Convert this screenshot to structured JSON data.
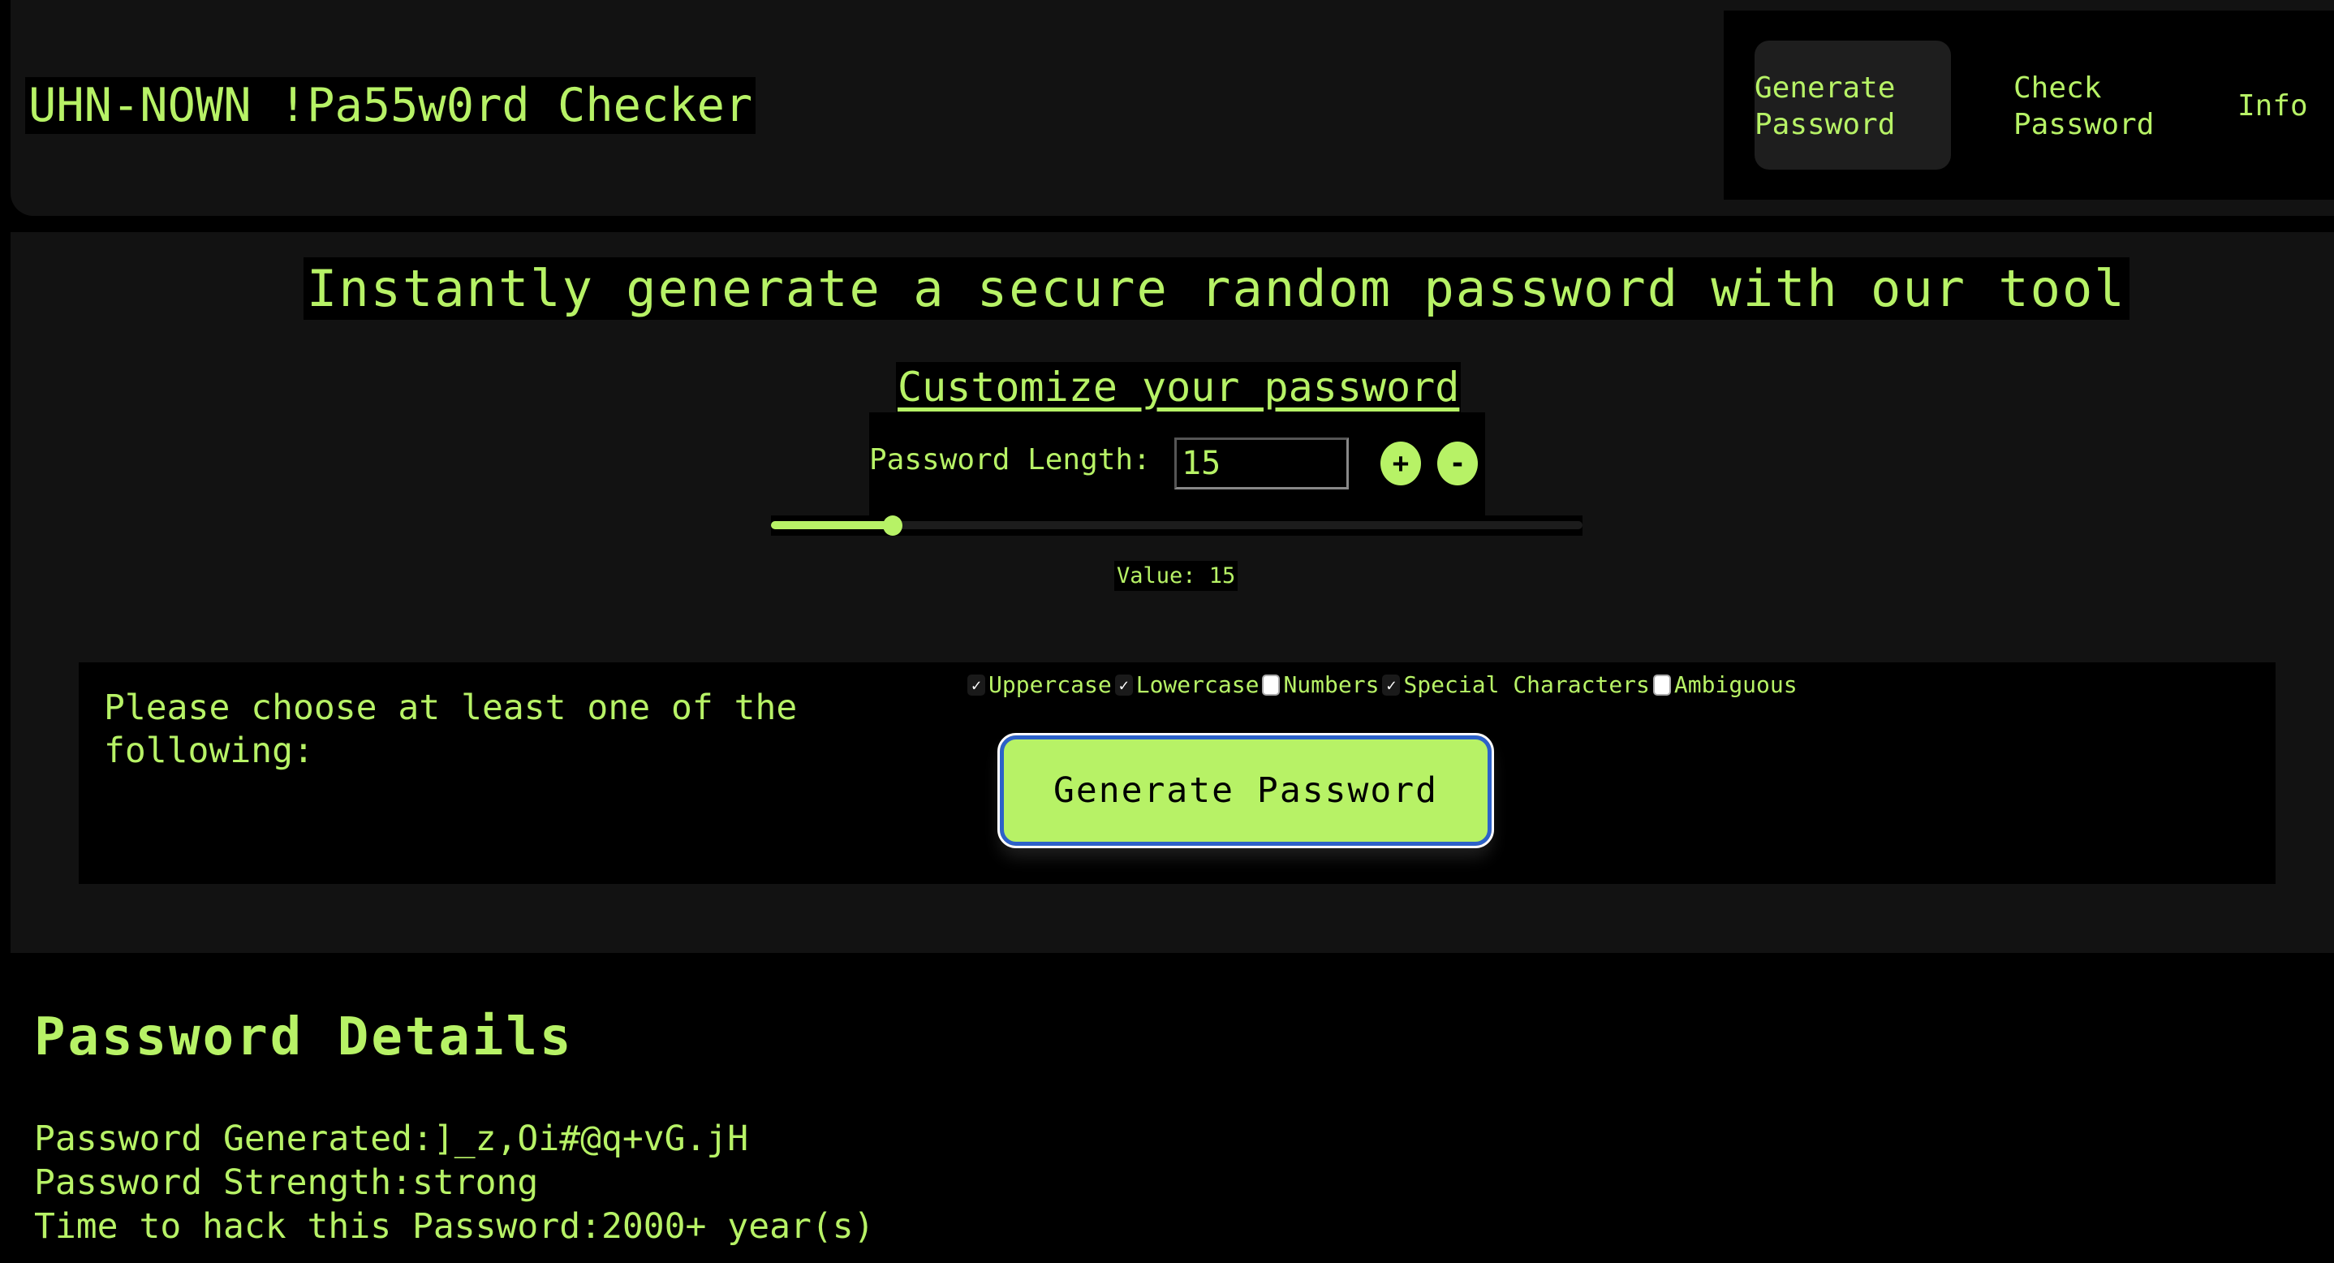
{
  "header": {
    "title": "UHN-NOWN !Pa55w0rd Checker",
    "nav": [
      {
        "label": "Generate\nPassword",
        "active": true
      },
      {
        "label": "Check\nPassword",
        "active": false
      },
      {
        "label": "Info",
        "active": false
      }
    ]
  },
  "main": {
    "headline": "Instantly generate a secure random password with our tool",
    "customize_heading": "Customize your password",
    "length_label": "Password Length:",
    "length_value": "15",
    "plus_label": "+",
    "minus_label": "-",
    "slider": {
      "value": 15,
      "fill_percent": 15
    },
    "value_text": "Value: 15",
    "choose_text": "Please choose at least one of the following:",
    "options": [
      {
        "label": "Uppercase",
        "checked": true
      },
      {
        "label": "Lowercase",
        "checked": true
      },
      {
        "label": "Numbers",
        "checked": false
      },
      {
        "label": "Special Characters",
        "checked": true
      },
      {
        "label": "Ambiguous",
        "checked": false
      }
    ],
    "generate_button": "Generate Password"
  },
  "details": {
    "heading": "Password Details",
    "generated": "Password Generated:]_z,Oi#@q+vG.jH",
    "strength": "Password Strength:strong",
    "time_to_hack": "Time to hack this Password:2000+ year(s)"
  },
  "colors": {
    "accent": "#b7f266",
    "background": "#000000",
    "panel": "#121212",
    "focus_ring": "#2d62c9"
  }
}
